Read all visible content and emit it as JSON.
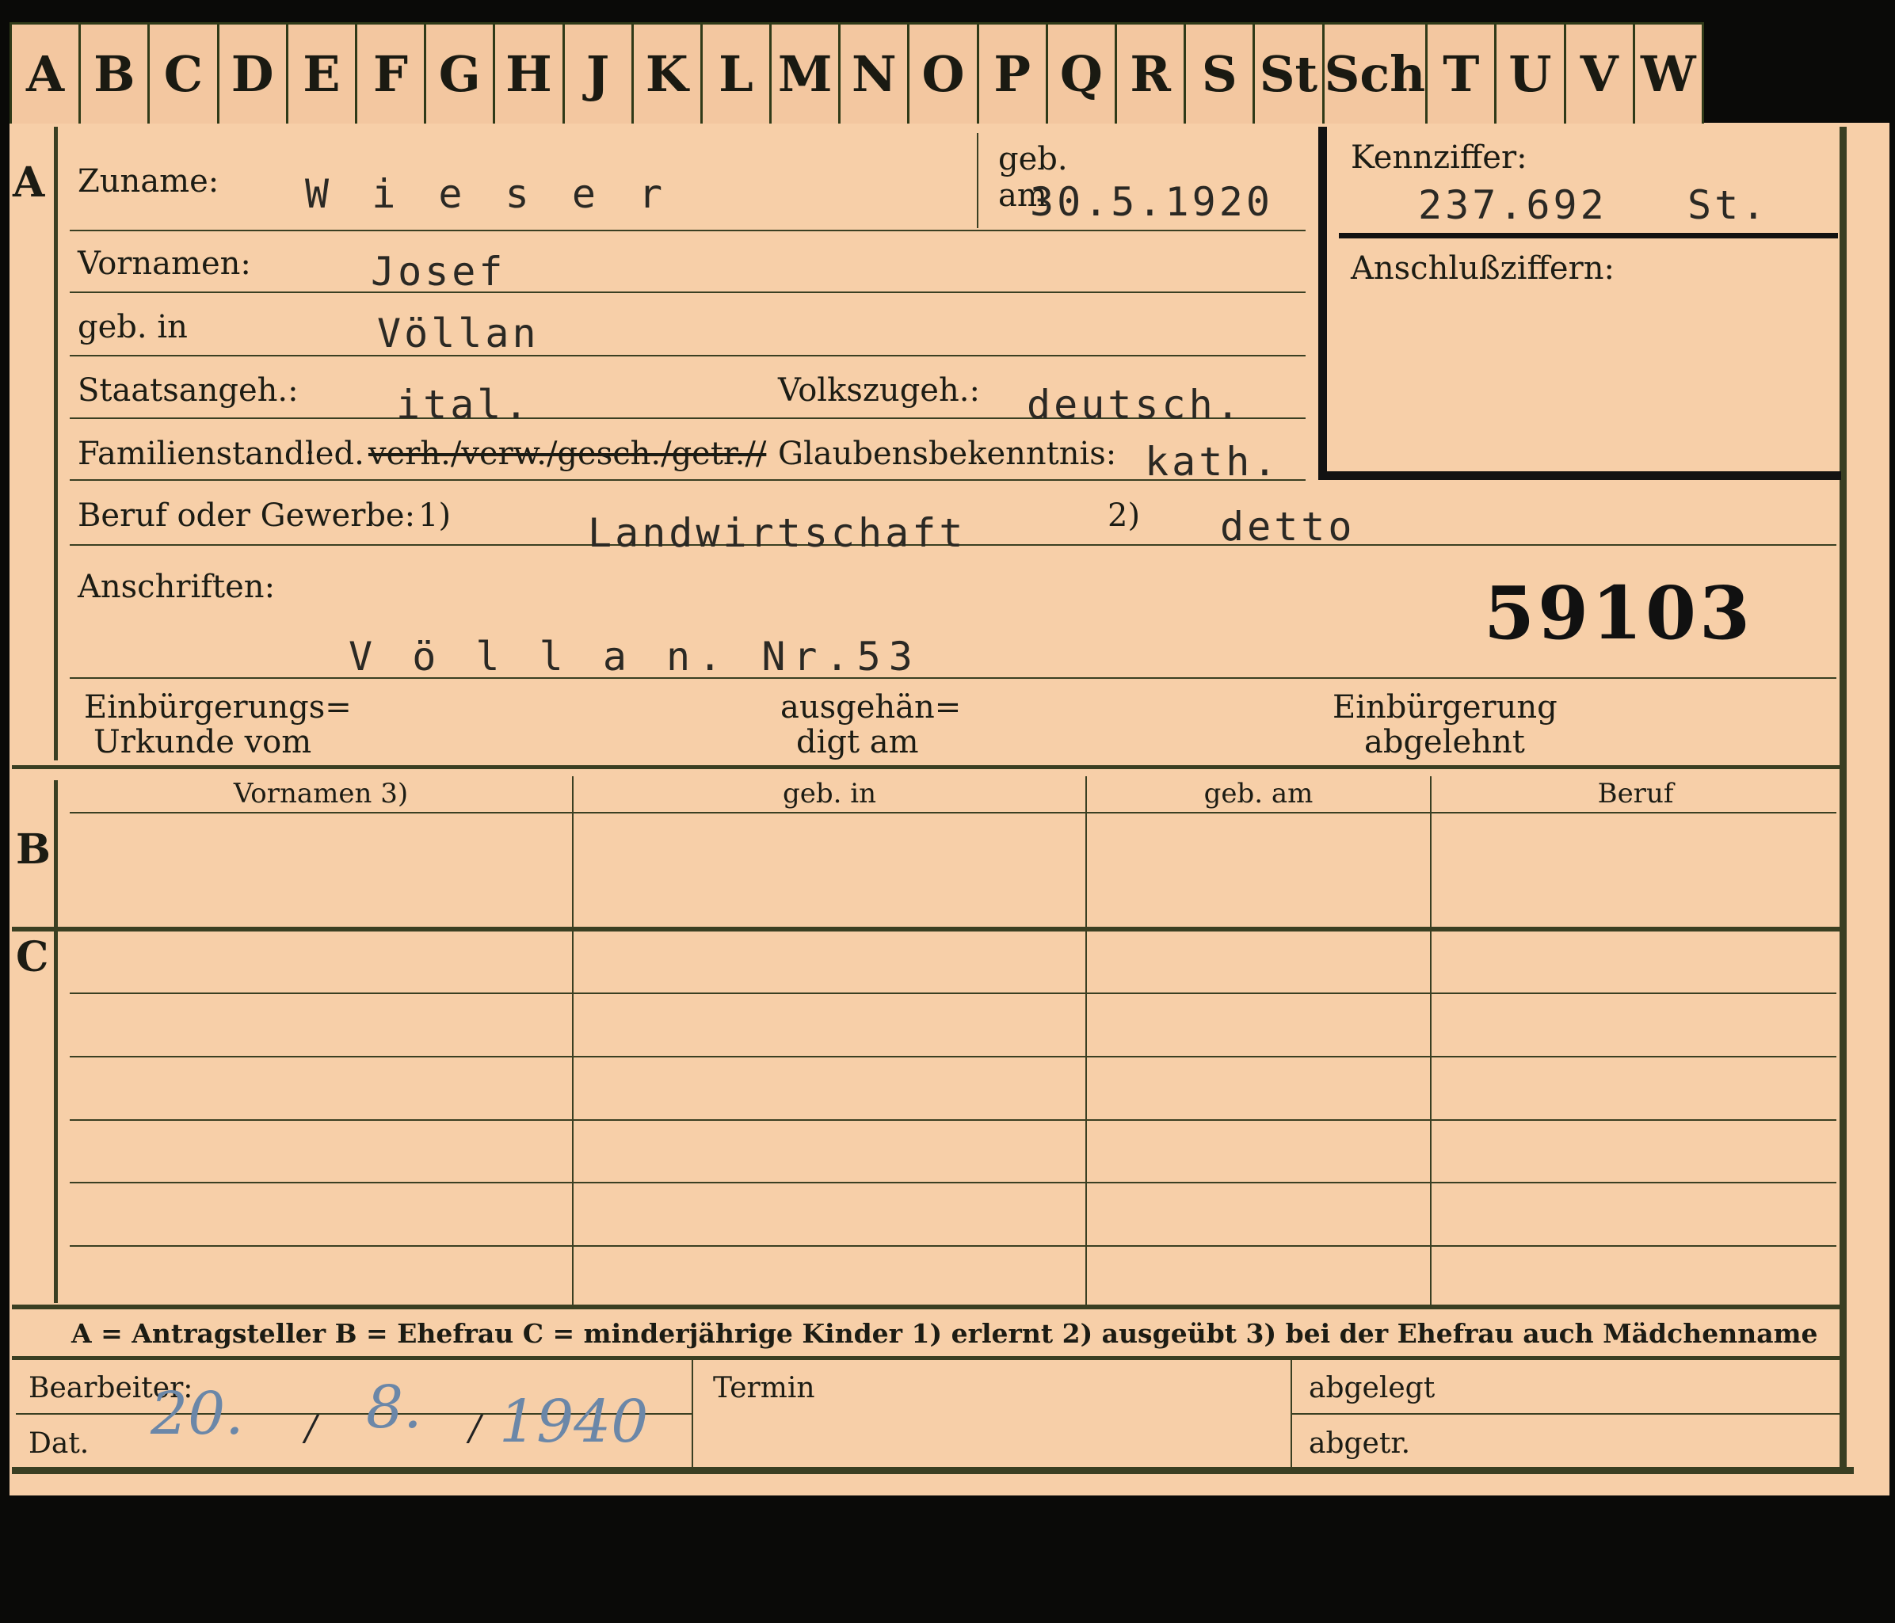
{
  "tabs": [
    "A",
    "B",
    "C",
    "D",
    "E",
    "F",
    "G",
    "H",
    "J",
    "K",
    "L",
    "M",
    "N",
    "O",
    "P",
    "Q",
    "R",
    "S",
    "St",
    "Sch",
    "T",
    "U",
    "V",
    "W"
  ],
  "section_marks": {
    "a": "A",
    "b": "B",
    "c": "C"
  },
  "labels": {
    "zuname": "Zuname:",
    "geb": "geb.",
    "am": "am",
    "kennziffer": "Kennziffer:",
    "anschlussziffern": "Anschlußziffern:",
    "vornamen": "Vornamen:",
    "geb_in": "geb. in",
    "staatsangeh": "Staatsangeh.:",
    "volkszugeh": "Volkszugeh.:",
    "familienstand": "Familienstand:",
    "glaubensbekenntnis": "Glaubensbekenntnis:",
    "beruf": "Beruf oder Gewerbe:",
    "ref1": "1)",
    "ref2": "2)",
    "anschriften": "Anschriften:",
    "einbuergerungs_1": "Einbürgerungs=",
    "einbuergerungs_2": "Urkunde vom",
    "ausgehaen_1": "ausgehän=",
    "ausgehaen_2": "digt am",
    "abgelehnt_1": "Einbürgerung",
    "abgelehnt_2": "abgelehnt",
    "bearbeiter": "Bearbeiter:",
    "dat": "Dat.",
    "termin": "Termin",
    "abgelegt": "abgelegt",
    "abgetr": "abgetr."
  },
  "values": {
    "zuname": "W i e s e r",
    "geb_am": "30.5.1920",
    "kennziffer": "237.692",
    "kennziffer_suffix": "St.",
    "vornamen": "Josef",
    "geb_in": "Völlan",
    "staatsangeh": "ital.",
    "volkszugeh": "deutsch.",
    "familienstand": "led.",
    "familienstand_struck": "verh./verw./gesch./getr.//",
    "glaubensbekenntnis": "kath.",
    "beruf_erlernt": "Landwirtschaft",
    "beruf_ausgeuebt": "detto",
    "stamp_number": "59103",
    "anschrift": "V ö l l a n. Nr.53"
  },
  "table_headers": [
    "Vornamen 3)",
    "geb. in",
    "geb. am",
    "Beruf"
  ],
  "legend": "A = Antragsteller   B = Ehefrau   C = minderjährige Kinder   1) erlernt   2) ausgeübt   3) bei der Ehefrau auch Mädchenname",
  "handwritten_date": {
    "day": "20.",
    "month": "8.",
    "year": "1940",
    "sep": "/"
  }
}
